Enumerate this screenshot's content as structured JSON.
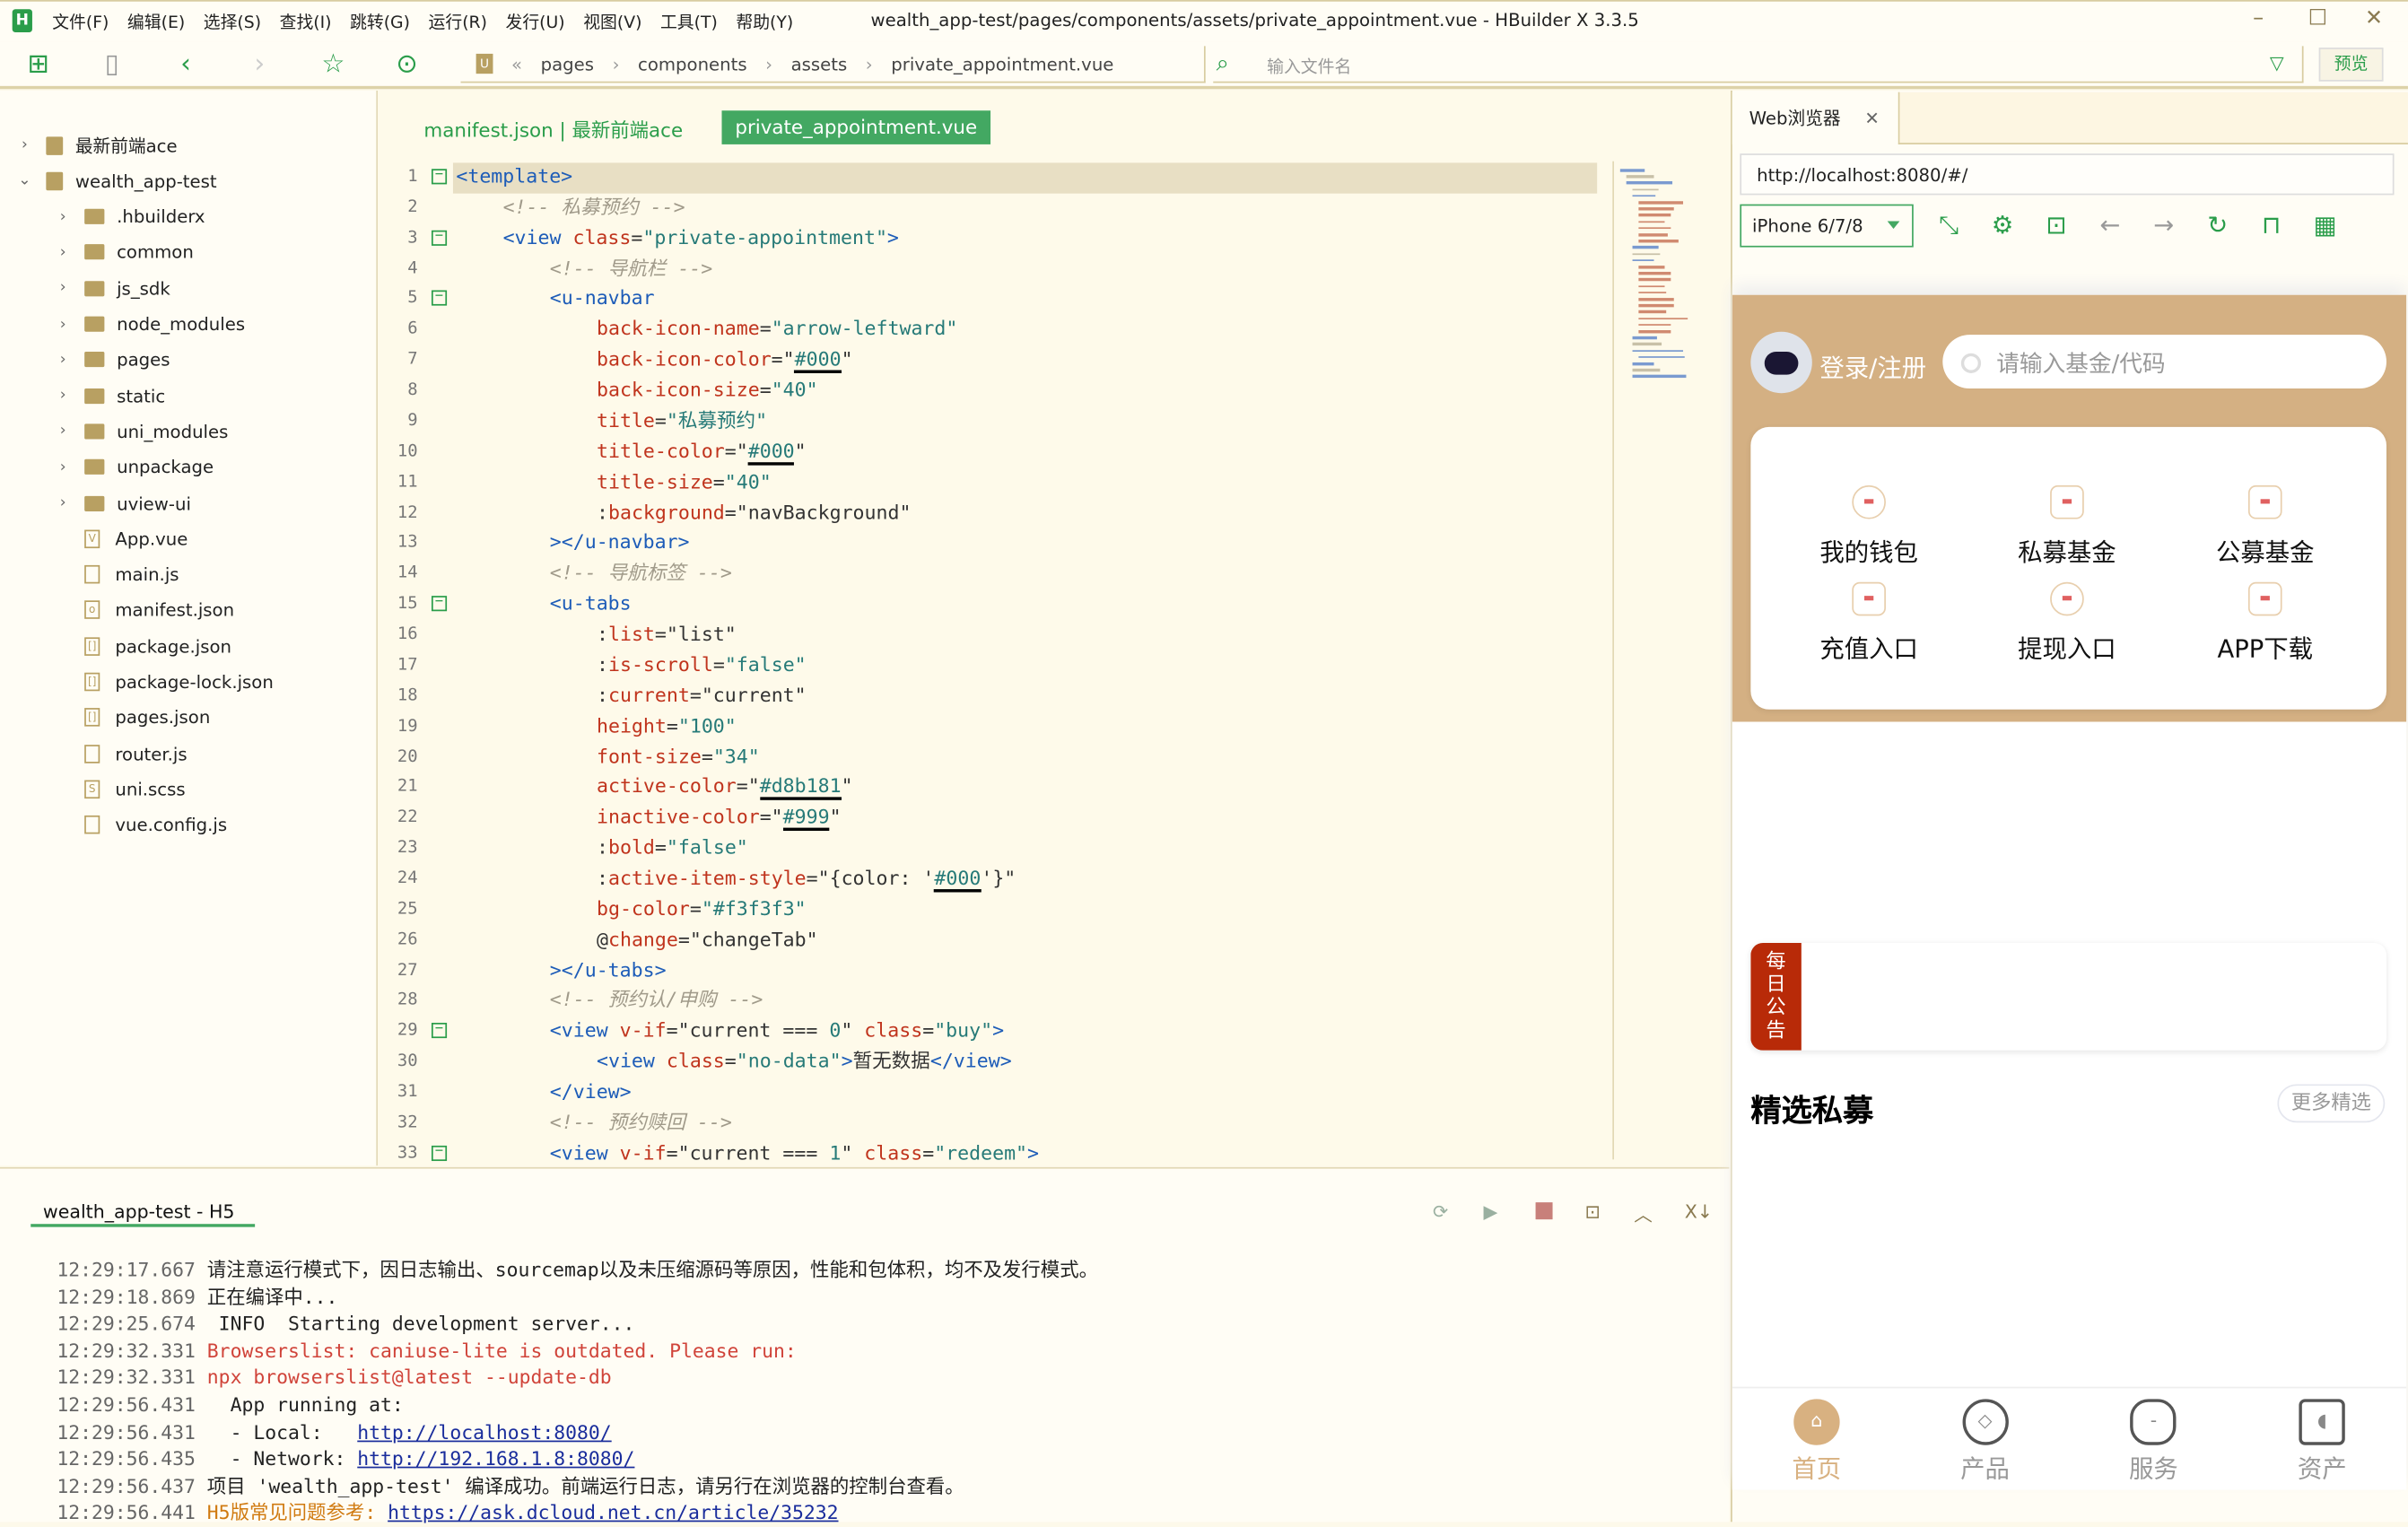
{
  "app": {
    "logo_letter": "H",
    "title": "wealth_app-test/pages/components/assets/private_appointment.vue - HBuilder X 3.3.5",
    "menu": [
      "文件(F)",
      "编辑(E)",
      "选择(S)",
      "查找(I)",
      "跳转(G)",
      "运行(R)",
      "发行(U)",
      "视图(V)",
      "工具(T)",
      "帮助(Y)"
    ],
    "window_controls": {
      "minimize": "–",
      "maximize": "☐",
      "close": "✕"
    }
  },
  "toolbar": {
    "breadcrumb": [
      "pages",
      "components",
      "assets",
      "private_appointment.vue"
    ],
    "file_search_placeholder": "输入文件名",
    "preview_label": "预览"
  },
  "sidebar": {
    "items": [
      {
        "label": "最新前端ace",
        "type": "project",
        "expanded": false,
        "depth": 0
      },
      {
        "label": "wealth_app-test",
        "type": "project",
        "expanded": true,
        "depth": 0
      },
      {
        "label": ".hbuilderx",
        "type": "folder",
        "depth": 1
      },
      {
        "label": "common",
        "type": "folder",
        "depth": 1
      },
      {
        "label": "js_sdk",
        "type": "folder",
        "depth": 1
      },
      {
        "label": "node_modules",
        "type": "folder",
        "depth": 1
      },
      {
        "label": "pages",
        "type": "folder",
        "depth": 1
      },
      {
        "label": "static",
        "type": "folder",
        "depth": 1
      },
      {
        "label": "uni_modules",
        "type": "folder",
        "depth": 1
      },
      {
        "label": "unpackage",
        "type": "folder",
        "depth": 1
      },
      {
        "label": "uview-ui",
        "type": "folder",
        "depth": 1
      },
      {
        "label": "App.vue",
        "type": "file",
        "glyph": "V",
        "depth": 1
      },
      {
        "label": "main.js",
        "type": "file",
        "glyph": "",
        "depth": 1
      },
      {
        "label": "manifest.json",
        "type": "file",
        "glyph": "o",
        "depth": 1
      },
      {
        "label": "package.json",
        "type": "file",
        "glyph": "[]",
        "depth": 1
      },
      {
        "label": "package-lock.json",
        "type": "file",
        "glyph": "[]",
        "depth": 1
      },
      {
        "label": "pages.json",
        "type": "file",
        "glyph": "[]",
        "depth": 1
      },
      {
        "label": "router.js",
        "type": "file",
        "glyph": "",
        "depth": 1
      },
      {
        "label": "uni.scss",
        "type": "file",
        "glyph": "S",
        "depth": 1
      },
      {
        "label": "vue.config.js",
        "type": "file",
        "glyph": "",
        "depth": 1
      }
    ]
  },
  "editor": {
    "tabs": [
      {
        "label": "manifest.json | 最新前端ace",
        "active": false
      },
      {
        "label": "private_appointment.vue",
        "active": true
      }
    ],
    "current_line": 1,
    "lines": [
      {
        "n": 1,
        "indent": 0,
        "fold": "-",
        "tokens": [
          [
            "tag",
            "<template>"
          ]
        ]
      },
      {
        "n": 2,
        "indent": 1,
        "tokens": [
          [
            "cmt",
            "<!-- 私募预约 -->"
          ]
        ]
      },
      {
        "n": 3,
        "indent": 1,
        "fold": "-",
        "tokens": [
          [
            "tag",
            "<view "
          ],
          [
            "attr",
            "class"
          ],
          [
            "txt",
            "="
          ],
          [
            "str",
            "\"private-appointment\""
          ],
          [
            "tag",
            ">"
          ]
        ]
      },
      {
        "n": 4,
        "indent": 2,
        "tokens": [
          [
            "cmt",
            "<!-- 导航栏 -->"
          ]
        ]
      },
      {
        "n": 5,
        "indent": 2,
        "fold": "-",
        "tokens": [
          [
            "tag",
            "<u-navbar"
          ]
        ]
      },
      {
        "n": 6,
        "indent": 3,
        "tokens": [
          [
            "attr",
            "back-icon-name"
          ],
          [
            "txt",
            "="
          ],
          [
            "str",
            "\"arrow-leftward\""
          ]
        ]
      },
      {
        "n": 7,
        "indent": 3,
        "tokens": [
          [
            "attr",
            "back-icon-color"
          ],
          [
            "txt",
            "=\""
          ],
          [
            "str u",
            "#000"
          ],
          [
            "txt",
            "\""
          ]
        ]
      },
      {
        "n": 8,
        "indent": 3,
        "tokens": [
          [
            "attr",
            "back-icon-size"
          ],
          [
            "txt",
            "="
          ],
          [
            "str",
            "\"40\""
          ]
        ]
      },
      {
        "n": 9,
        "indent": 3,
        "tokens": [
          [
            "attr",
            "title"
          ],
          [
            "txt",
            "="
          ],
          [
            "str",
            "\"私募预约\""
          ]
        ]
      },
      {
        "n": 10,
        "indent": 3,
        "tokens": [
          [
            "attr",
            "title-color"
          ],
          [
            "txt",
            "=\""
          ],
          [
            "str u",
            "#000"
          ],
          [
            "txt",
            "\""
          ]
        ]
      },
      {
        "n": 11,
        "indent": 3,
        "tokens": [
          [
            "attr",
            "title-size"
          ],
          [
            "txt",
            "="
          ],
          [
            "str",
            "\"40\""
          ]
        ]
      },
      {
        "n": 12,
        "indent": 3,
        "tokens": [
          [
            "txt",
            ":"
          ],
          [
            "attr",
            "background"
          ],
          [
            "txt",
            "=\"navBackground\""
          ]
        ]
      },
      {
        "n": 13,
        "indent": 2,
        "tokens": [
          [
            "tag",
            "></u-navbar>"
          ]
        ]
      },
      {
        "n": 14,
        "indent": 2,
        "tokens": [
          [
            "cmt",
            "<!-- 导航标签 -->"
          ]
        ]
      },
      {
        "n": 15,
        "indent": 2,
        "fold": "-",
        "tokens": [
          [
            "tag",
            "<u-tabs"
          ]
        ]
      },
      {
        "n": 16,
        "indent": 3,
        "tokens": [
          [
            "txt",
            ":"
          ],
          [
            "attr",
            "list"
          ],
          [
            "txt",
            "=\"list\""
          ]
        ]
      },
      {
        "n": 17,
        "indent": 3,
        "tokens": [
          [
            "txt",
            ":"
          ],
          [
            "attr",
            "is-scroll"
          ],
          [
            "txt",
            "="
          ],
          [
            "str",
            "\"false\""
          ]
        ]
      },
      {
        "n": 18,
        "indent": 3,
        "tokens": [
          [
            "txt",
            ":"
          ],
          [
            "attr",
            "current"
          ],
          [
            "txt",
            "=\"current\""
          ]
        ]
      },
      {
        "n": 19,
        "indent": 3,
        "tokens": [
          [
            "attr",
            "height"
          ],
          [
            "txt",
            "="
          ],
          [
            "str",
            "\"100\""
          ]
        ]
      },
      {
        "n": 20,
        "indent": 3,
        "tokens": [
          [
            "attr",
            "font-size"
          ],
          [
            "txt",
            "="
          ],
          [
            "str",
            "\"34\""
          ]
        ]
      },
      {
        "n": 21,
        "indent": 3,
        "tokens": [
          [
            "attr",
            "active-color"
          ],
          [
            "txt",
            "=\""
          ],
          [
            "str u",
            "#d8b181"
          ],
          [
            "txt",
            "\""
          ]
        ]
      },
      {
        "n": 22,
        "indent": 3,
        "tokens": [
          [
            "attr",
            "inactive-color"
          ],
          [
            "txt",
            "=\""
          ],
          [
            "str u",
            "#999"
          ],
          [
            "txt",
            "\""
          ]
        ]
      },
      {
        "n": 23,
        "indent": 3,
        "tokens": [
          [
            "txt",
            ":"
          ],
          [
            "attr",
            "bold"
          ],
          [
            "txt",
            "="
          ],
          [
            "str",
            "\"false\""
          ]
        ]
      },
      {
        "n": 24,
        "indent": 3,
        "tokens": [
          [
            "txt",
            ":"
          ],
          [
            "attr",
            "active-item-style"
          ],
          [
            "txt",
            "=\"{color: '"
          ],
          [
            "str u",
            "#000"
          ],
          [
            "txt",
            "'}\""
          ]
        ]
      },
      {
        "n": 25,
        "indent": 3,
        "tokens": [
          [
            "attr",
            "bg-color"
          ],
          [
            "txt",
            "="
          ],
          [
            "str",
            "\"#f3f3f3\""
          ]
        ]
      },
      {
        "n": 26,
        "indent": 3,
        "tokens": [
          [
            "txt",
            "@"
          ],
          [
            "attr",
            "change"
          ],
          [
            "txt",
            "=\"changeTab\""
          ]
        ]
      },
      {
        "n": 27,
        "indent": 2,
        "tokens": [
          [
            "tag",
            "></u-tabs>"
          ]
        ]
      },
      {
        "n": 28,
        "indent": 2,
        "tokens": [
          [
            "cmt",
            "<!-- 预约认/申购 -->"
          ]
        ]
      },
      {
        "n": 29,
        "indent": 2,
        "fold": "-",
        "tokens": [
          [
            "tag",
            "<view "
          ],
          [
            "attr",
            "v-if"
          ],
          [
            "txt",
            "=\"current === "
          ],
          [
            "str",
            "0"
          ],
          [
            "txt",
            "\" "
          ],
          [
            "attr",
            "class"
          ],
          [
            "txt",
            "="
          ],
          [
            "str",
            "\"buy\""
          ],
          [
            "tag",
            ">"
          ]
        ]
      },
      {
        "n": 30,
        "indent": 3,
        "tokens": [
          [
            "tag",
            "<view "
          ],
          [
            "attr",
            "class"
          ],
          [
            "txt",
            "="
          ],
          [
            "str",
            "\"no-data\""
          ],
          [
            "tag",
            ">"
          ],
          [
            "txt",
            "暂无数据"
          ],
          [
            "tag",
            "</view>"
          ]
        ]
      },
      {
        "n": 31,
        "indent": 2,
        "tokens": [
          [
            "tag",
            "</view>"
          ]
        ]
      },
      {
        "n": 32,
        "indent": 2,
        "tokens": [
          [
            "cmt",
            "<!-- 预约赎回 -->"
          ]
        ]
      },
      {
        "n": 33,
        "indent": 2,
        "fold": "-",
        "tokens": [
          [
            "tag",
            "<view "
          ],
          [
            "attr",
            "v-if"
          ],
          [
            "txt",
            "=\"current === "
          ],
          [
            "str",
            "1"
          ],
          [
            "txt",
            "\" "
          ],
          [
            "attr",
            "class"
          ],
          [
            "txt",
            "="
          ],
          [
            "str",
            "\"redeem\""
          ],
          [
            "tag",
            ">"
          ]
        ]
      }
    ]
  },
  "console": {
    "tab_label": "wealth_app-test - H5",
    "lines": [
      {
        "ts": "12:29:17.667",
        "parts": [
          [
            "normal",
            " 请注意运行模式下，因日志输出、sourcemap以及未压缩源码等原因，性能和包体积，均不及发行模式。"
          ]
        ]
      },
      {
        "ts": "12:29:18.869",
        "parts": [
          [
            "normal",
            " 正在编译中..."
          ]
        ]
      },
      {
        "ts": "12:29:25.674",
        "parts": [
          [
            "normal",
            "  INFO  Starting development server..."
          ]
        ]
      },
      {
        "ts": "12:29:32.331",
        "parts": [
          [
            "warn",
            " Browserslist: caniuse-lite is outdated. Please run:"
          ]
        ]
      },
      {
        "ts": "12:29:32.331",
        "parts": [
          [
            "warn",
            " npx browserslist@latest --update-db"
          ]
        ]
      },
      {
        "ts": "12:29:56.431",
        "parts": [
          [
            "normal",
            "   App running at:"
          ]
        ]
      },
      {
        "ts": "12:29:56.431",
        "parts": [
          [
            "normal",
            "   - Local:   "
          ],
          [
            "link",
            "http://localhost:8080/"
          ]
        ]
      },
      {
        "ts": "12:29:56.435",
        "parts": [
          [
            "normal",
            "   - Network: "
          ],
          [
            "link",
            "http://192.168.1.8:8080/"
          ]
        ]
      },
      {
        "ts": "12:29:56.437",
        "parts": [
          [
            "normal",
            " 项目 'wealth_app-test' 编译成功。前端运行日志，请另行在浏览器的控制台查看。"
          ]
        ]
      },
      {
        "ts": "12:29:56.441",
        "parts": [
          [
            "orange",
            " H5版常见问题参考: "
          ],
          [
            "link",
            "https://ask.dcloud.net.cn/article/35232"
          ]
        ]
      }
    ]
  },
  "browser": {
    "tab_label": "Web浏览器",
    "url": "http://localhost:8080/#/",
    "device": "iPhone 6/7/8",
    "phone": {
      "login_label": "登录/注册",
      "search_placeholder": "请输入基金/代码",
      "entries": [
        "我的钱包",
        "私募基金",
        "公募基金",
        "充值入口",
        "提现入口",
        "APP下载"
      ],
      "notice_tag": "每日公告",
      "section_title": "精选私募",
      "more_label": "更多精选",
      "tabs": [
        {
          "label": "首页",
          "active": true
        },
        {
          "label": "产品",
          "active": false
        },
        {
          "label": "服务",
          "active": false
        },
        {
          "label": "资产",
          "active": false
        }
      ],
      "colors": {
        "header": "#d4b083",
        "accent": "#d8b181",
        "notice": "#b82a08"
      }
    }
  }
}
